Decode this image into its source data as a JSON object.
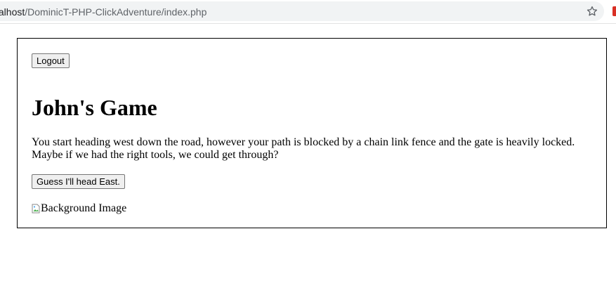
{
  "browser": {
    "url_host": "localhost",
    "url_path": "/DominicT-PHP-ClickAdventure/index.php",
    "bookmark_icon": "star-icon"
  },
  "page": {
    "logout_label": "Logout",
    "title": "John's Game",
    "story_text": "You start heading west down the road, however your path is blocked by a chain link fence and the gate is heavily locked. Maybe if we had the right tools, we could get through?",
    "head_east_label": "Guess I'll head East.",
    "background_image_alt": "Background Image"
  }
}
